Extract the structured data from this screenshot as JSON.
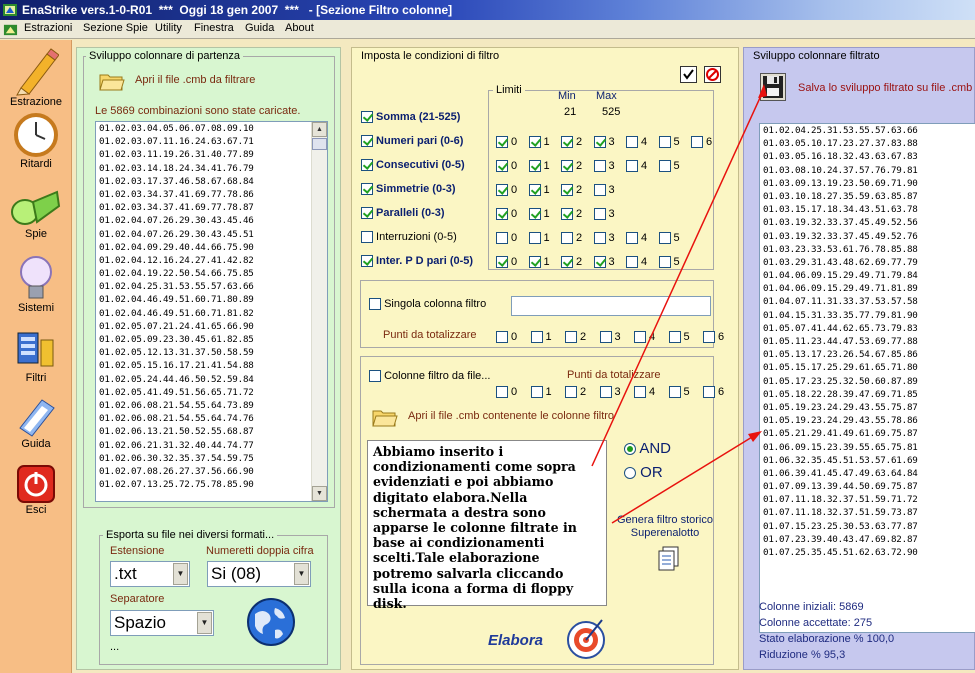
{
  "window": {
    "title": "EnaStrike vers.1-0-R01  ***  Oggi 18 gen 2007  ***   - [Sezione Filtro colonne]"
  },
  "menu": [
    "Estrazioni",
    "Sezione Spie",
    "Utility",
    "Finestra",
    "Guida",
    "About"
  ],
  "sidebar": [
    "Estrazione",
    "Ritardi",
    "Spie",
    "Sistemi",
    "Filtri",
    "Guida",
    "Esci"
  ],
  "left": {
    "group_label": "Sviluppo colonnare di partenza",
    "open_label": "Apri il  file .cmb da filtrare",
    "loaded_text": "Le 5869 combinazioni sono state caricate.",
    "rows": [
      "01.02.03.04.05.06.07.08.09.10",
      "01.02.03.07.11.16.24.63.67.71",
      "01.02.03.11.19.26.31.40.77.89",
      "01.02.03.14.18.24.34.41.76.79",
      "01.02.03.17.37.46.58.67.68.84",
      "01.02.03.34.37.41.69.77.78.86",
      "01.02.03.34.37.41.69.77.78.87",
      "01.02.04.07.26.29.30.43.45.46",
      "01.02.04.07.26.29.30.43.45.51",
      "01.02.04.09.29.40.44.66.75.90",
      "01.02.04.12.16.24.27.41.42.82",
      "01.02.04.19.22.50.54.66.75.85",
      "01.02.04.25.31.53.55.57.63.66",
      "01.02.04.46.49.51.60.71.80.89",
      "01.02.04.46.49.51.60.71.81.82",
      "01.02.05.07.21.24.41.65.66.90",
      "01.02.05.09.23.30.45.61.82.85",
      "01.02.05.12.13.31.37.50.58.59",
      "01.02.05.15.16.17.21.41.54.88",
      "01.02.05.24.44.46.50.52.59.84",
      "01.02.05.41.49.51.56.65.71.72",
      "01.02.06.08.21.54.55.64.73.89",
      "01.02.06.08.21.54.55.64.74.76",
      "01.02.06.13.21.50.52.55.68.87",
      "01.02.06.21.31.32.40.44.74.77",
      "01.02.06.30.32.35.37.54.59.75",
      "01.02.07.08.26.27.37.56.66.90",
      "01.02.07.13.25.72.75.78.85.90"
    ],
    "export_label": "Esporta su file nei diversi formati...",
    "ext_label": "Estensione",
    "ext_value": ".txt",
    "num_label": "Numeretti doppia cifra",
    "num_value": "Si (08)",
    "sep_label": "Separatore",
    "sep_value": "Spazio",
    "ellipsis": "..."
  },
  "middle": {
    "group_label": "Imposta le condizioni di filtro",
    "limits_label": "Limiti",
    "min_label": "Min",
    "max_label": "Max",
    "min_value": "21",
    "max_value": "525",
    "filters": [
      {
        "label": "Somma (21-525)",
        "checked": true,
        "boxes": []
      },
      {
        "label": "Numeri pari (0-6)",
        "checked": true,
        "boxes": [
          [
            "0",
            true
          ],
          [
            "1",
            true
          ],
          [
            "2",
            true
          ],
          [
            "3",
            true
          ],
          [
            "4",
            false
          ],
          [
            "5",
            false
          ],
          [
            "6",
            false
          ]
        ]
      },
      {
        "label": "Consecutivi (0-5)",
        "checked": true,
        "boxes": [
          [
            "0",
            true
          ],
          [
            "1",
            true
          ],
          [
            "2",
            true
          ],
          [
            "3",
            false
          ],
          [
            "4",
            false
          ],
          [
            "5",
            false
          ]
        ]
      },
      {
        "label": "Simmetrie (0-3)",
        "checked": true,
        "boxes": [
          [
            "0",
            true
          ],
          [
            "1",
            true
          ],
          [
            "2",
            true
          ],
          [
            "3",
            false
          ]
        ]
      },
      {
        "label": "Paralleli (0-3)",
        "checked": true,
        "boxes": [
          [
            "0",
            true
          ],
          [
            "1",
            true
          ],
          [
            "2",
            true
          ],
          [
            "3",
            false
          ]
        ]
      },
      {
        "label": "Interruzioni (0-5)",
        "checked": false,
        "boxes": [
          [
            "0",
            false
          ],
          [
            "1",
            false
          ],
          [
            "2",
            false
          ],
          [
            "3",
            false
          ],
          [
            "4",
            false
          ],
          [
            "5",
            false
          ]
        ]
      },
      {
        "label": "Inter. P D pari (0-5)",
        "checked": true,
        "boxes": [
          [
            "0",
            true
          ],
          [
            "1",
            true
          ],
          [
            "2",
            true
          ],
          [
            "3",
            true
          ],
          [
            "4",
            false
          ],
          [
            "5",
            false
          ]
        ]
      }
    ],
    "single_label": "Singola colonna filtro",
    "punti_label": "Punti da totalizzare",
    "punti_boxes": [
      "0",
      "1",
      "2",
      "3",
      "4",
      "5",
      "6"
    ],
    "file_label": "Colonne filtro da file...",
    "punti2_label": "Punti da totalizzare",
    "open2_label": "Apri il  file .cmb contenente le colonne filtro",
    "and_label": "AND",
    "or_label": "OR",
    "storico_label": "Genera filtro storico Superenalotto",
    "elabora_label": "Elabora",
    "note": "Abbiamo inserito i condizionamenti come sopra evidenziati e poi abbiamo digitato elabora.Nella schermata a destra sono apparse le colonne filtrate in base ai condizionamenti scelti.Tale elaborazione potremo salvarla cliccando sulla icona a forma di floppy disk."
  },
  "right": {
    "group_label": "Sviluppo colonnare filtrato",
    "save_label": "Salva lo sviluppo filtrato su file .cmb",
    "rows": [
      "01.02.04.25.31.53.55.57.63.66",
      "01.03.05.10.17.23.27.37.83.88",
      "01.03.05.16.18.32.43.63.67.83",
      "01.03.08.10.24.37.57.76.79.81",
      "01.03.09.13.19.23.50.69.71.90",
      "01.03.10.18.27.35.59.63.85.87",
      "01.03.15.17.18.34.43.51.63.78",
      "01.03.19.32.33.37.45.49.52.56",
      "01.03.19.32.33.37.45.49.52.76",
      "01.03.23.33.53.61.76.78.85.88",
      "01.03.29.31.43.48.62.69.77.79",
      "01.04.06.09.15.29.49.71.79.84",
      "01.04.06.09.15.29.49.71.81.89",
      "01.04.07.11.31.33.37.53.57.58",
      "01.04.15.31.33.35.77.79.81.90",
      "01.05.07.41.44.62.65.73.79.83",
      "01.05.11.23.44.47.53.69.77.88",
      "01.05.13.17.23.26.54.67.85.86",
      "01.05.15.17.25.29.61.65.71.80",
      "01.05.17.23.25.32.50.60.87.89",
      "01.05.18.22.28.39.47.69.71.85",
      "01.05.19.23.24.29.43.55.75.87",
      "01.05.19.23.24.29.43.55.78.86",
      "01.05.21.29.41.49.61.69.75.87",
      "01.06.09.15.23.39.55.65.75.81",
      "01.06.32.35.45.51.53.57.61.69",
      "01.06.39.41.45.47.49.63.64.84",
      "01.07.09.13.39.44.50.69.75.87",
      "01.07.11.18.32.37.51.59.71.72",
      "01.07.11.18.32.37.51.59.73.87",
      "01.07.15.23.25.30.53.63.77.87",
      "01.07.23.39.40.43.47.69.82.87",
      "01.07.25.35.45.51.62.63.72.90"
    ],
    "stats": [
      "Colonne iniziali: 5869",
      "Colonne accettate:  275",
      "Stato elaborazione %  100,0",
      "Riduzione %   95,3"
    ]
  },
  "colors": {
    "accent_red": "#e8120e",
    "panel_green": "#d8f6d0",
    "panel_yellow": "#fbf6c4",
    "panel_lilac": "#c6c8ee",
    "sidebar": "#f7be85"
  }
}
